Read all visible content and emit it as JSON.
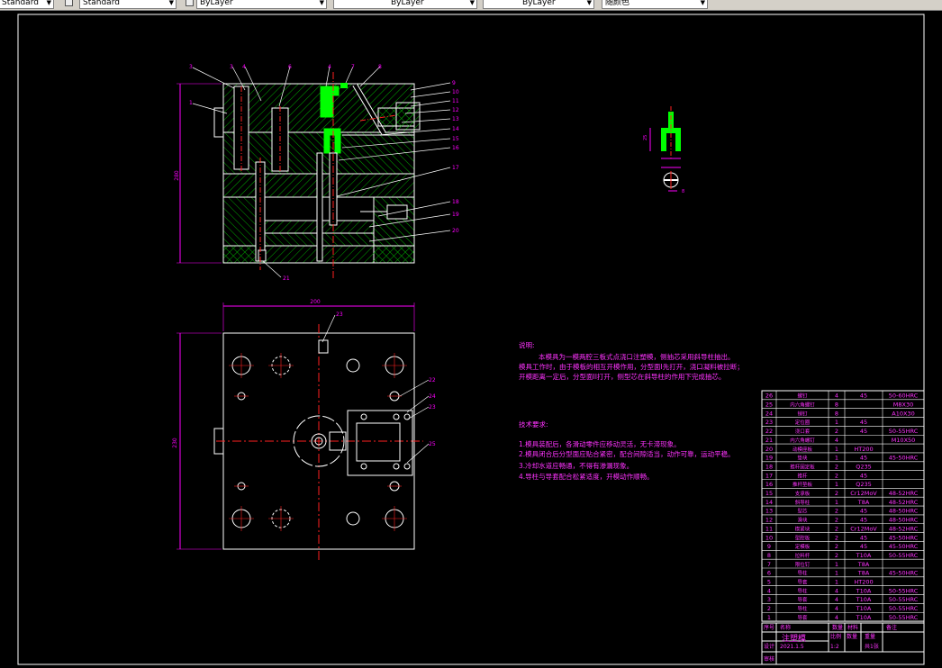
{
  "toolbar": {
    "text_style": "Standard",
    "dim_style": "Standard",
    "layer_color": "ByLayer",
    "linetype": "ByLayer",
    "lineweight": "ByLayer",
    "plotstyle": "随颜色"
  },
  "dims": {
    "front_height": "280",
    "plan_width": "200",
    "plan_height": "230",
    "detail_height": "25",
    "detail_width": "8"
  },
  "callouts": [
    "1",
    "2",
    "3",
    "4",
    "5",
    "6",
    "7",
    "8",
    "9",
    "10",
    "11",
    "12",
    "13",
    "14",
    "15",
    "16",
    "17",
    "18",
    "19",
    "20",
    "21",
    "22",
    "23",
    "24",
    "25",
    "26"
  ],
  "notes": {
    "heading": "说明:",
    "lines": [
      "本模具为一模两腔三板式点浇口注塑模，侧抽芯采用斜导柱抽出。",
      "模具工作时，由于模板的相互开模作用，分型面I先打开，浇口凝料被拉断；",
      "开模距离一定后，分型面II打开，侧型芯在斜导柱的作用下完成抽芯。"
    ]
  },
  "tech": {
    "heading": "技术要求:",
    "lines": [
      "1.模具装配后，各滑动零件应移动灵活，无卡滞现象。",
      "2.模具闭合后分型面应贴合紧密，配合间隙适当，动作可靠，运动平稳。",
      "3.冷却水道应畅通，不得有渗漏现象。",
      "4.导柱与导套配合松紧适度，开模动作顺畅。"
    ]
  },
  "bom": [
    [
      "26",
      "螺钉",
      "4",
      "45",
      "50-60HRC"
    ],
    [
      "25",
      "内六角螺钉",
      "8",
      "",
      "M8X30"
    ],
    [
      "24",
      "销钉",
      "8",
      "",
      "A10X30"
    ],
    [
      "23",
      "定位圈",
      "1",
      "45",
      ""
    ],
    [
      "22",
      "浇口套",
      "2",
      "45",
      "50-55HRC"
    ],
    [
      "21",
      "内六角螺钉",
      "4",
      "",
      "M10X50"
    ],
    [
      "20",
      "动模座板",
      "1",
      "HT200",
      ""
    ],
    [
      "19",
      "垫块",
      "1",
      "45",
      "45-50HRC"
    ],
    [
      "18",
      "推杆固定板",
      "2",
      "Q235",
      ""
    ],
    [
      "17",
      "推杆",
      "2",
      "45",
      ""
    ],
    [
      "16",
      "推杆垫板",
      "1",
      "Q235",
      ""
    ],
    [
      "15",
      "支承板",
      "2",
      "Cr12MoV",
      "48-52HRC"
    ],
    [
      "14",
      "斜导柱",
      "1",
      "T8A",
      "48-52HRC"
    ],
    [
      "13",
      "型芯",
      "2",
      "45",
      "48-50HRC"
    ],
    [
      "12",
      "滑块",
      "2",
      "45",
      "48-50HRC"
    ],
    [
      "11",
      "楔紧块",
      "2",
      "Cr12MoV",
      "48-52HRC"
    ],
    [
      "10",
      "型腔板",
      "2",
      "45",
      "45-50HRC"
    ],
    [
      "9",
      "定模板",
      "2",
      "45",
      "45-50HRC"
    ],
    [
      "8",
      "拉料杆",
      "2",
      "T10A",
      "50-55HRC"
    ],
    [
      "7",
      "限位钉",
      "1",
      "T8A",
      ""
    ],
    [
      "6",
      "导柱",
      "1",
      "T8A",
      "45-50HRC"
    ],
    [
      "5",
      "导套",
      "1",
      "HT200",
      ""
    ],
    [
      "4",
      "导柱",
      "4",
      "T10A",
      "50-55HRC"
    ],
    [
      "3",
      "导套",
      "4",
      "T10A",
      "50-55HRC"
    ],
    [
      "2",
      "导柱",
      "4",
      "T10A",
      "50-55HRC"
    ],
    [
      "1",
      "导套",
      "4",
      "T10A",
      "50-55HRC"
    ]
  ],
  "bom_header": [
    "序号",
    "名称",
    "数量",
    "材料",
    "备注"
  ],
  "title_block": {
    "name": "注塑模",
    "scale_label": "比例",
    "scale": "1:2",
    "qty_label": "数量",
    "weight_label": "重量",
    "sheet_label": "共1张",
    "designer": "设计",
    "reviewer": "审核",
    "date": "2021.1.5"
  },
  "colors": {
    "background": "#000000",
    "outline": "#ffffff",
    "hatch": "#00cc00",
    "highlight": "#00ff00",
    "center": "#ff2020",
    "dim": "#ff00ff",
    "text": "#ff00ff",
    "magenta_bright": "#ff33ff"
  }
}
